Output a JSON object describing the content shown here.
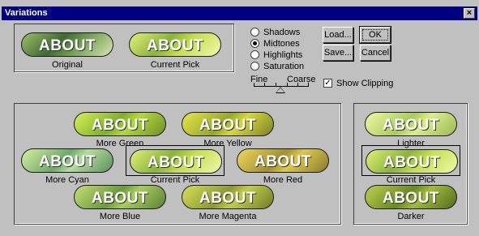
{
  "window": {
    "title": "Variations",
    "close_glyph": "×"
  },
  "thumbnail_word": "ABOUT",
  "top": {
    "original_label": "Original",
    "current_pick_label": "Current Pick"
  },
  "options": [
    {
      "label": "Shadows",
      "selected": false
    },
    {
      "label": "Midtones",
      "selected": true
    },
    {
      "label": "Highlights",
      "selected": false
    },
    {
      "label": "Saturation",
      "selected": false
    }
  ],
  "slider": {
    "fine_label": "Fine",
    "coarse_label": "Coarse"
  },
  "show_clipping": {
    "label": "Show Clipping",
    "checked": true,
    "check_glyph": "✓"
  },
  "buttons": {
    "load": "Load...",
    "ok": "OK",
    "save": "Save...",
    "cancel": "Cancel"
  },
  "variations": {
    "more_green": "More Green",
    "more_yellow": "More Yellow",
    "more_cyan": "More Cyan",
    "current_pick": "Current Pick",
    "more_red": "More Red",
    "more_blue": "More Blue",
    "more_magenta": "More Magenta"
  },
  "lightness": {
    "lighter": "Lighter",
    "current_pick": "Current Pick",
    "darker": "Darker"
  },
  "colors": {
    "titlebar": "#000080",
    "face": "#c0c0c0",
    "original_tint": "#4a7a3a",
    "pick_tint": "#b8d838"
  }
}
